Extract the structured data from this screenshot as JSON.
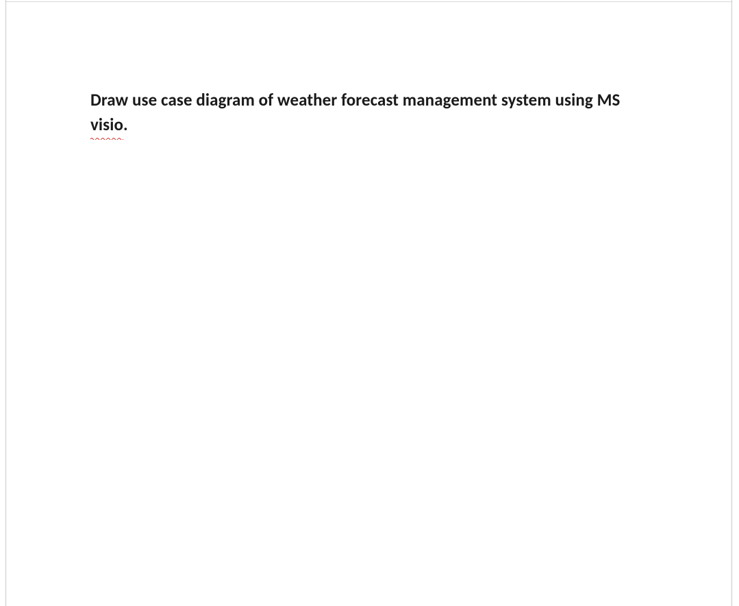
{
  "document": {
    "paragraph": {
      "leading": "Draw use case diagram of weather forecast management system using MS ",
      "misspelled_word": "visio",
      "trailing": "."
    }
  }
}
